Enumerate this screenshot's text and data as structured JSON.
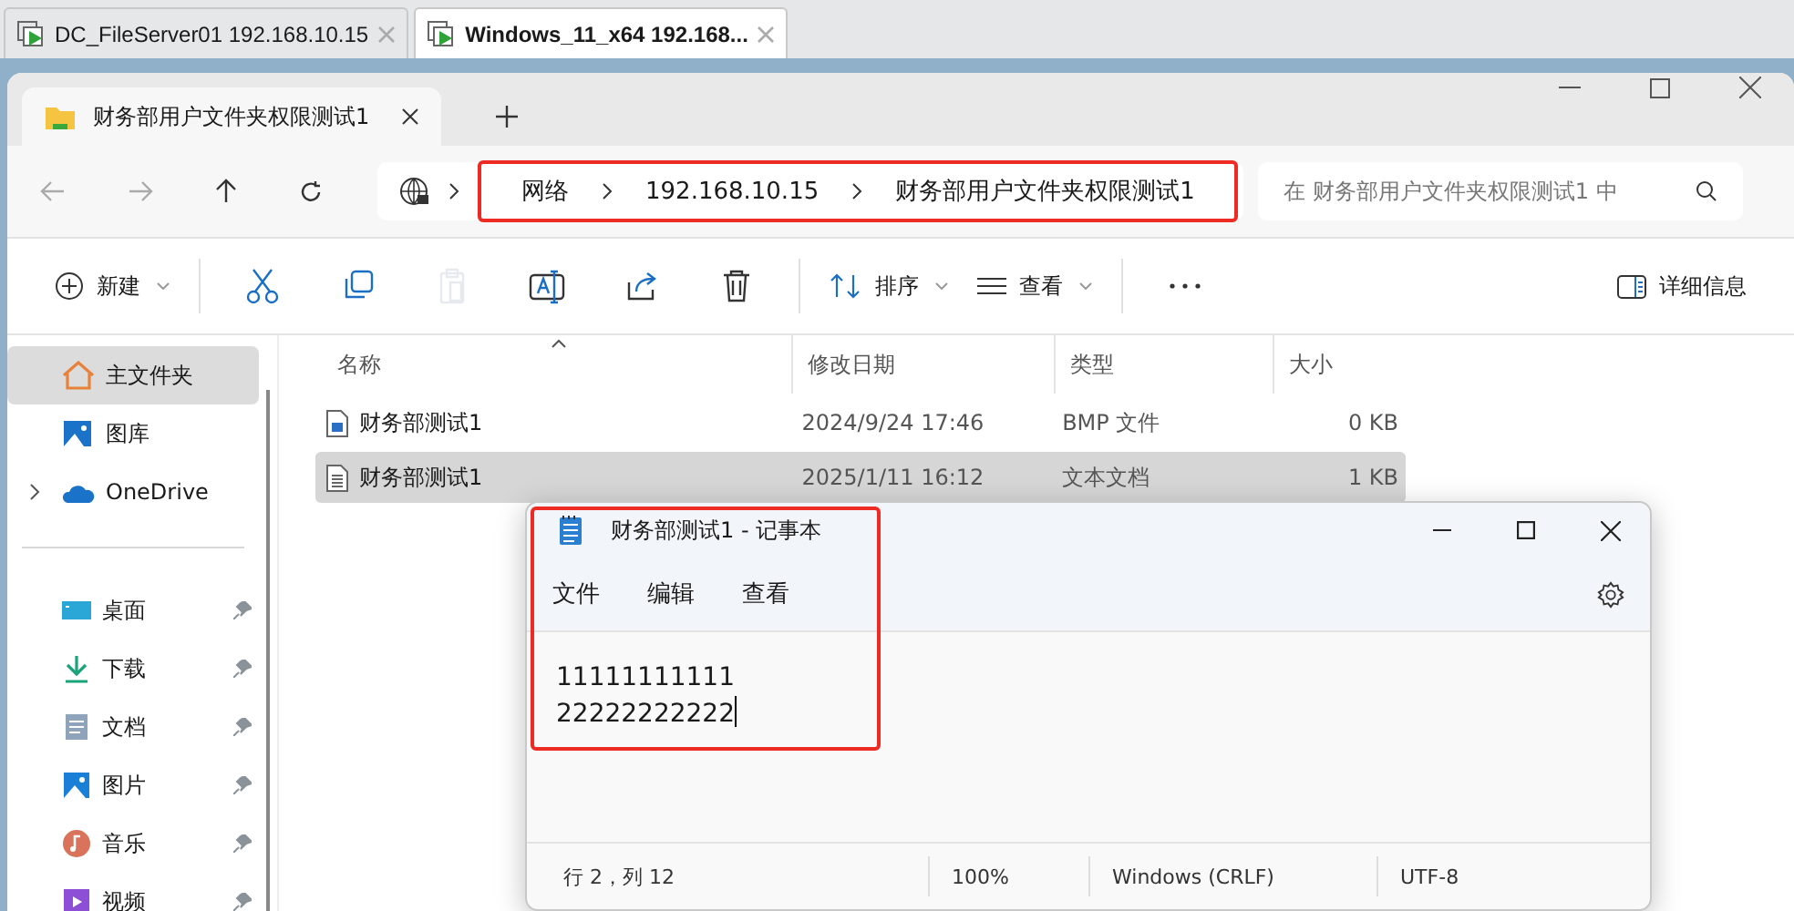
{
  "vm_tabs": [
    {
      "label": "DC_FileServer01 192.168.10.15",
      "selected": false
    },
    {
      "label": "Windows_11_x64 192.168...",
      "selected": true
    }
  ],
  "explorer": {
    "tab_title": "财务部用户文件夹权限测试1",
    "breadcrumbs": [
      "网络",
      "192.168.10.15",
      "财务部用户文件夹权限测试1"
    ],
    "search": {
      "placeholder": "在 财务部用户文件夹权限测试1 中"
    },
    "toolbar": [
      {
        "kind": "new",
        "label": "新建",
        "disabled": false
      },
      {
        "kind": "cut",
        "disabled": false
      },
      {
        "kind": "copy",
        "disabled": false
      },
      {
        "kind": "paste",
        "disabled": true
      },
      {
        "kind": "rename",
        "disabled": false
      },
      {
        "kind": "share",
        "disabled": false
      },
      {
        "kind": "delete",
        "disabled": false
      },
      {
        "kind": "sort",
        "label": "排序",
        "disabled": false
      },
      {
        "kind": "view",
        "label": "查看",
        "disabled": false
      },
      {
        "kind": "more",
        "disabled": false
      }
    ],
    "details_button": "详细信息",
    "sidebar": {
      "top": [
        {
          "label": "主文件夹",
          "kind": "home",
          "selected": true
        },
        {
          "label": "图库",
          "kind": "gallery",
          "selected": false
        },
        {
          "label": "OneDrive",
          "kind": "cloud",
          "selected": false,
          "expandable": true
        }
      ],
      "pinned": [
        {
          "label": "桌面",
          "kind": "desktop",
          "selected": false
        },
        {
          "label": "下载",
          "kind": "download",
          "selected": false
        },
        {
          "label": "文档",
          "kind": "docs",
          "selected": false
        },
        {
          "label": "图片",
          "kind": "pictures",
          "selected": false
        },
        {
          "label": "音乐",
          "kind": "music",
          "selected": false
        },
        {
          "label": "视频",
          "kind": "video",
          "selected": false
        }
      ]
    },
    "columns": [
      "名称",
      "修改日期",
      "类型",
      "大小"
    ],
    "rows": [
      {
        "name": "财务部测试1",
        "kind": "image",
        "date": "2024/9/24 17:46",
        "type": "BMP 文件",
        "size": "0 KB",
        "selected": false
      },
      {
        "name": "财务部测试1",
        "kind": "text",
        "date": "2025/1/11 16:12",
        "type": "文本文档",
        "size": "1 KB",
        "selected": true
      }
    ]
  },
  "notepad": {
    "title": "财务部测试1 - 记事本",
    "menus": [
      "文件",
      "编辑",
      "查看"
    ],
    "lines": [
      "11111111111",
      "22222222222"
    ],
    "status": [
      "行 2，列 12",
      "100%",
      "Windows (CRLF)",
      "UTF-8"
    ]
  }
}
